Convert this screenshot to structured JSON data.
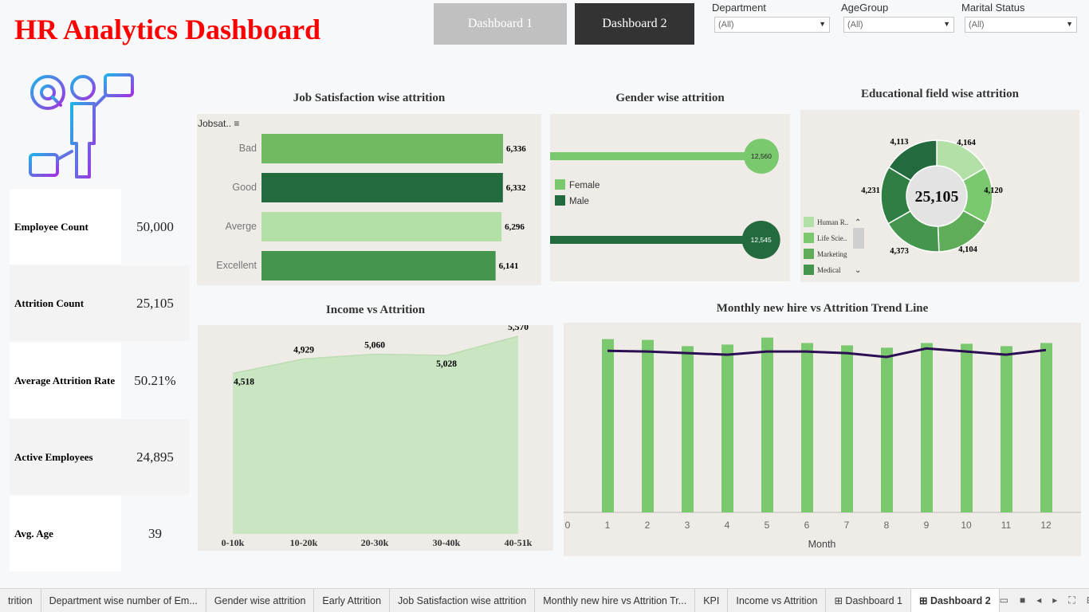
{
  "header": {
    "title": "HR Analytics Dashboard"
  },
  "nav": {
    "btn1": "Dashboard 1",
    "btn2": "Dashboard 2"
  },
  "filters": [
    {
      "label": "Department",
      "value": "(All)"
    },
    {
      "label": "AgeGroup",
      "value": "(All)"
    },
    {
      "label": "Marital Status",
      "value": "(All)"
    }
  ],
  "kpis": [
    {
      "label": "Employee Count",
      "value": "50,000"
    },
    {
      "label": "Attrition Count",
      "value": "25,105"
    },
    {
      "label": "Average Attrition Rate",
      "value": "50.21%"
    },
    {
      "label": "Active Employees",
      "value": "24,895"
    },
    {
      "label": "Avg. Age",
      "value": "39"
    }
  ],
  "colors": {
    "dark": "#236b3e",
    "mid": "#44964f",
    "light": "#7bc96f",
    "pale": "#b3e0a6",
    "line": "#2b0f52",
    "area": "#c9e5c1",
    "title_red": "#ff0000"
  },
  "chart_data": [
    {
      "type": "bar",
      "title": "Job Satisfaction wise attrition",
      "header": "Jobsat..",
      "categories": [
        "Bad",
        "Good",
        "Averge",
        "Excellent"
      ],
      "values": [
        6336,
        6332,
        6296,
        6141
      ],
      "labels": [
        "6,336",
        "6,332",
        "6,296",
        "6,141"
      ],
      "colors": [
        "#72b963",
        "#236b3e",
        "#b3e0a6",
        "#44964f"
      ]
    },
    {
      "type": "bar",
      "title": "Gender wise attrition",
      "categories": [
        "Female",
        "Male"
      ],
      "values": [
        12560,
        12545
      ],
      "labels": [
        "12,560",
        "12,545"
      ],
      "colors": [
        "#7bc96f",
        "#236b3e"
      ],
      "legend": [
        "Female",
        "Male"
      ]
    },
    {
      "type": "pie",
      "title": "Educational field wise attrition",
      "center_label": "25,105",
      "slices": [
        4164,
        4120,
        4104,
        4373,
        4231,
        4113
      ],
      "slice_labels": [
        "4,164",
        "4,120",
        "4,104",
        "4,373",
        "4,231",
        "4,113"
      ],
      "colors": [
        "#b3e0a6",
        "#7bc96f",
        "#5fad58",
        "#44964f",
        "#2f7f43",
        "#236b3e"
      ],
      "legend": [
        "Human R..",
        "Life Scie..",
        "Marketing",
        "Medical"
      ]
    },
    {
      "type": "area",
      "title": "Income vs Attrition",
      "categories": [
        "0-10k",
        "10-20k",
        "20-30k",
        "30-40k",
        "40-51k"
      ],
      "values": [
        4518,
        4929,
        5060,
        5028,
        5570
      ],
      "labels": [
        "4,518",
        "4,929",
        "5,060",
        "5,028",
        "5,570"
      ],
      "ylim": [
        0,
        5700
      ]
    },
    {
      "type": "bar",
      "title": "Monthly new hire vs Attrition Trend Line",
      "xlabel": "Month",
      "x_ticks": [
        "0",
        "1",
        "2",
        "3",
        "4",
        "5",
        "6",
        "7",
        "8",
        "9",
        "10",
        "11",
        "12",
        "13"
      ],
      "x": [
        1,
        2,
        3,
        4,
        5,
        6,
        7,
        8,
        9,
        10,
        11,
        12
      ],
      "bars": [
        2230,
        2220,
        2140,
        2160,
        2250,
        2180,
        2150,
        2120,
        2180,
        2170,
        2140,
        2180
      ],
      "line": [
        2080,
        2070,
        2050,
        2030,
        2070,
        2070,
        2050,
        2000,
        2110,
        2070,
        2030,
        2090
      ],
      "ylim": [
        0,
        2400
      ]
    }
  ],
  "tabs": [
    "trition",
    "Department wise number of Em...",
    "Gender wise attrition",
    "Early Attrition",
    "Job Satisfaction wise attrition",
    "Monthly new hire vs Attrition Tr...",
    "KPI",
    "Income vs Attrition",
    "Dashboard 1",
    "Dashboard 2"
  ]
}
